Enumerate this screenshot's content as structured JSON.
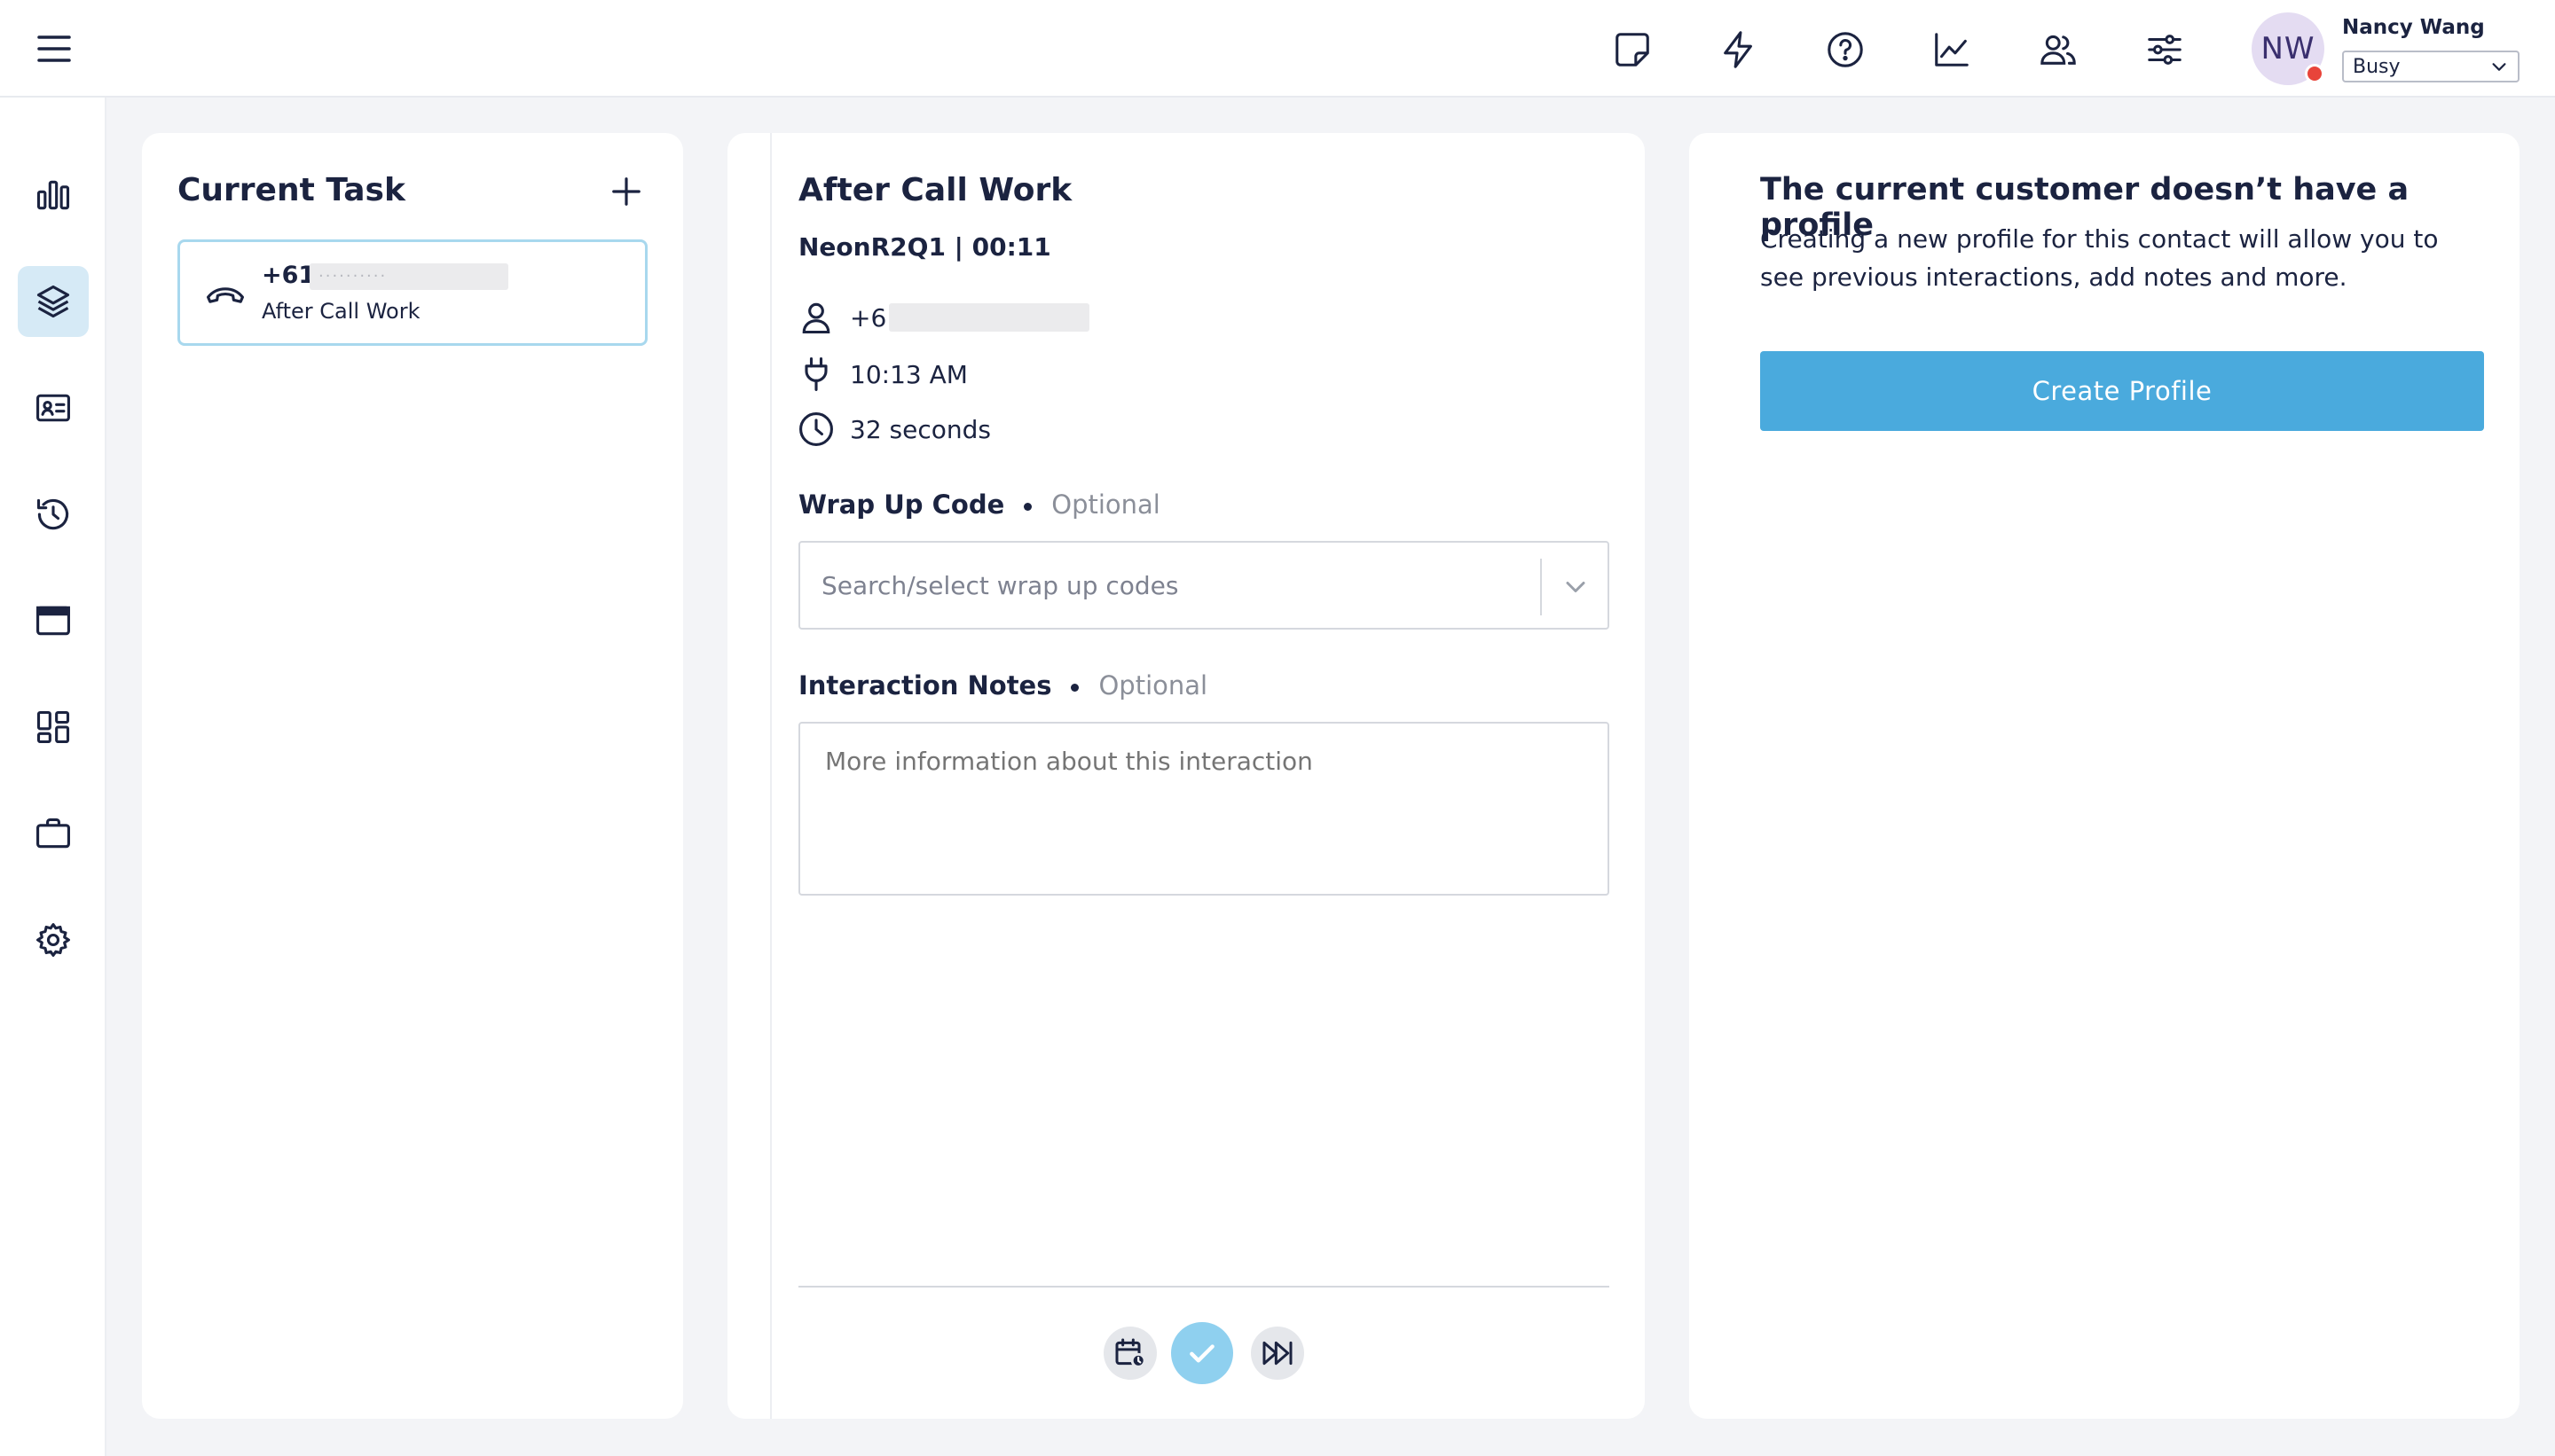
{
  "header": {
    "user": {
      "initials": "NW",
      "name": "Nancy Wang",
      "status": "Busy"
    },
    "icons": [
      "sticky-note-icon",
      "lightning-icon",
      "help-icon",
      "chart-line-icon",
      "users-icon",
      "sliders-icon"
    ]
  },
  "sidebar": {
    "items": [
      {
        "name": "dashboard",
        "icon": "bar-chart-icon",
        "active": false
      },
      {
        "name": "tasks",
        "icon": "layers-icon",
        "active": true
      },
      {
        "name": "contacts",
        "icon": "contact-card-icon",
        "active": false
      },
      {
        "name": "history",
        "icon": "history-icon",
        "active": false
      },
      {
        "name": "browser",
        "icon": "window-icon",
        "active": false
      },
      {
        "name": "apps",
        "icon": "grid-icon",
        "active": false
      },
      {
        "name": "work",
        "icon": "briefcase-icon",
        "active": false
      },
      {
        "name": "settings",
        "icon": "gear-icon",
        "active": false
      }
    ]
  },
  "current_task": {
    "title": "Current Task",
    "task": {
      "number": "+61",
      "masked": "··········",
      "status": "After Call Work"
    }
  },
  "after_call": {
    "title": "After Call Work",
    "meta": "NeonR2Q1 | 00:11",
    "phone": "+61",
    "time": "10:13 AM",
    "duration": "32 seconds",
    "wrap_up": {
      "label": "Wrap Up Code",
      "optional": "Optional",
      "placeholder": "Search/select wrap up codes"
    },
    "notes": {
      "label": "Interaction Notes",
      "optional": "Optional",
      "placeholder": "More information about this interaction"
    }
  },
  "profile": {
    "title": "The current customer doesn’t have a profile",
    "description": "Creating a new profile for this contact will allow you to see previous interactions, add notes and more.",
    "button": "Create Profile"
  },
  "colors": {
    "accent": "#4aaadd",
    "active_bg": "#d6eaf6",
    "status_busy": "#e8443a",
    "text": "#1b2340"
  }
}
